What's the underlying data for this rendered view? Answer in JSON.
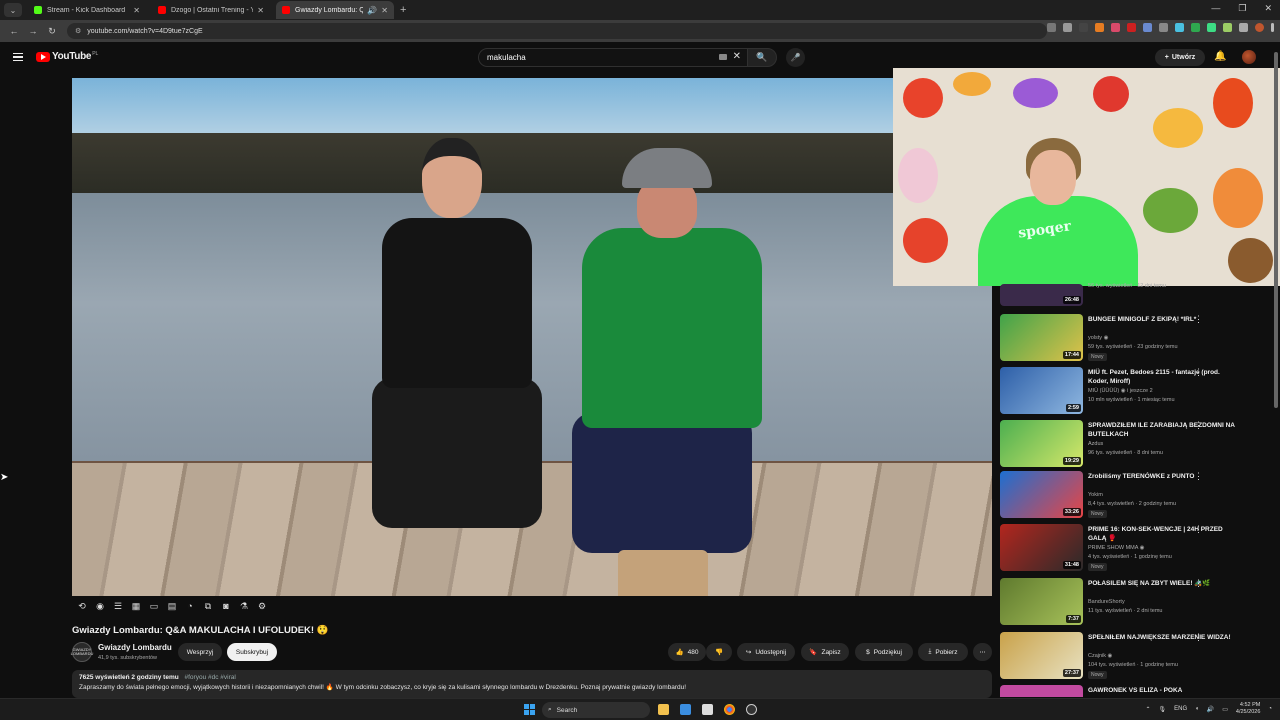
{
  "browser": {
    "tabs": [
      {
        "label": "Stream - Kick Dashboard",
        "color": "#53fc18"
      },
      {
        "label": "Dzogo | Ostatni Trening - YouTube",
        "color": "#ff0000"
      },
      {
        "label": "Gwiazdy Lombardu: Q&A M",
        "color": "#ff0000"
      }
    ],
    "url": "youtube.com/watch?v=4D9tue7zCgE",
    "new_tab_label": "+"
  },
  "youtube": {
    "logo_text": "YouTube",
    "region": "PL",
    "search_value": "makulacha",
    "create_label": "Utwórz"
  },
  "video": {
    "title": "Gwiazdy Lombardu: Q&A MAKULACHA I UFOLUDEK! 😲",
    "channel": {
      "name": "Gwiazdy Lombardu",
      "subs": "41,9 tys. subskrybentów",
      "avatar_text": "GWIAZDY LOMBARDU"
    },
    "join_label": "Wesprzyj",
    "subscribe_label": "Subskrybuj",
    "likes": "480",
    "share_label": "Udostępnij",
    "save_label": "Zapisz",
    "thanks_label": "Podziękuj",
    "download_label": "Pobierz",
    "description": {
      "meta": "7625 wyświetleń  2 godziny temu",
      "tags": "#foryou #dc #viral",
      "text": "Zapraszamy do świata pełnego emocji, wyjątkowych historii i niezapomnianych chwil! 🔥 W tym odcinku zobaczysz, co kryje się za kulisami słynnego lombardu w Drezdenku. Poznaj prywatnie gwiazdy lombardu!"
    },
    "overlay_text": "spoqer"
  },
  "recommendations": [
    {
      "title": "",
      "channel": "",
      "views": "56 tys. wyświetleń · 12 dni temu",
      "duration": "26:48",
      "new": "",
      "thumb": "#3a2a4a"
    },
    {
      "title": "BUNGEE MINIGOLF Z EKIPĄ! *IRL*",
      "channel": "yolsty ◉",
      "views": "59 tys. wyświetleń · 23 godziny temu",
      "duration": "17:44",
      "new": "Nowy",
      "thumb": "#3fa34a"
    },
    {
      "title": "MIÜ ft. Pezet, Bedoes 2115 - fantazje (prod. Koder, Miroff)",
      "channel": "MIÜ (ÜÜÜÜ) ◉ i jeszcze 2",
      "views": "10 mln wyświetleń · 1 miesiąc temu",
      "duration": "2:59",
      "new": "",
      "thumb": "#2d5fa8"
    },
    {
      "title": "SPRAWDZIŁEM ILE ZARABIAJĄ BEZDOMNI NA BUTELKACH",
      "channel": "Azdus",
      "views": "96 tys. wyświetleń · 8 dni temu",
      "duration": "19:29",
      "new": "",
      "thumb": "#4caf50"
    },
    {
      "title": "Zrobiliśmy TERENÓWKE z PUNTO",
      "channel": "Yokim",
      "views": "8,4 tys. wyświetleń · 2 godziny temu",
      "duration": "33:26",
      "new": "Nowy",
      "thumb": "#1d6fd1"
    },
    {
      "title": "PRIME 16: KON-SEK-WENCJE | 24H PRZED GALĄ 🥊",
      "channel": "PRIME SHOW MMA ◉",
      "views": "4 tys. wyświetleń · 1 godzinę temu",
      "duration": "31:48",
      "new": "Nowy",
      "thumb": "#b3261e"
    },
    {
      "title": "POŁASILEM SIĘ NA ZBYT WIELE! 🚜🌿",
      "channel": "BandureShorty",
      "views": "11 tys. wyświetleń · 2 dni temu",
      "duration": "7:37",
      "new": "",
      "thumb": "#5f7a2e"
    },
    {
      "title": "SPEŁNIŁEM NAJWIĘKSZE MARZENIE WIDZA!",
      "channel": "Czajnik ◉",
      "views": "104 tys. wyświetleń · 1 godzinę temu",
      "duration": "27:37",
      "new": "Nowy",
      "thumb": "#c9a24a"
    },
    {
      "title": "GAWRONEK VS ELIZA - POKA",
      "channel": "",
      "views": "",
      "duration": "",
      "new": "",
      "thumb": "#c24aa0"
    }
  ],
  "taskbar": {
    "search_label": "Search",
    "lang": "ENG",
    "time": "4:52 PM",
    "date": "4/25/2026"
  },
  "colors": {
    "accent": "#ff0000",
    "bg": "#0f0f0f"
  }
}
